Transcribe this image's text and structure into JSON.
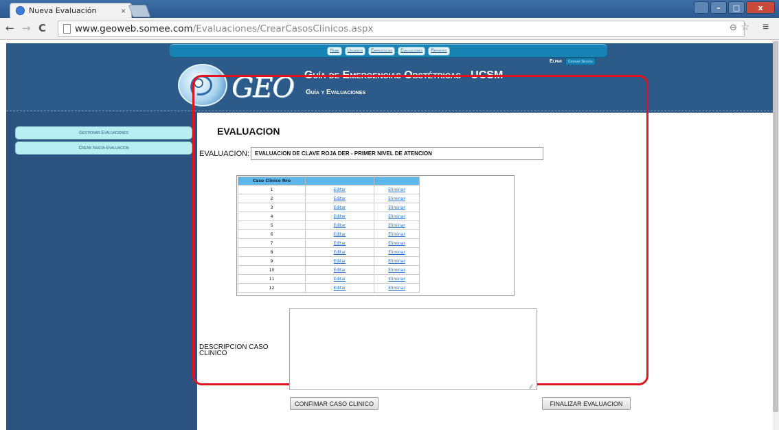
{
  "browser": {
    "tab_title": "Nueva Evaluación",
    "tab_close": "×",
    "url_domain": "www.geoweb.somee.com",
    "url_path": "/Evaluaciones/CrearCasosClinicos.aspx",
    "nav_back": "←",
    "nav_forward": "→",
    "nav_reload": "C",
    "zoom_icon": "🔍",
    "star_icon": "☆",
    "menu_icon": "≡"
  },
  "header": {
    "menu": [
      "Home",
      "Usuarios",
      "Emergencias",
      "Evaluaciones",
      "Reportes"
    ],
    "user_name": "Elper",
    "logout_label": "Cerrar Sesión",
    "logo_text": "GEO",
    "title": "Guía de Emergencias Obstétricas - UCSM",
    "subtitle": "Guía y Evaluaciones"
  },
  "sidebar": {
    "items": [
      "Gestionar Evaluaciones",
      "Crear Nueva Evaluacion"
    ]
  },
  "main": {
    "title": "EVALUACION",
    "eval_label": "EVALUACION:",
    "eval_value": "EVALUACION DE CLAVE ROJA DER - PRIMER NIVEL DE ATENCION",
    "grid": {
      "headers": [
        "Caso Clinico Nro",
        "",
        ""
      ],
      "edit_label": "Editar",
      "delete_label": "Eliminar",
      "rows": [
        "1",
        "2",
        "3",
        "4",
        "5",
        "6",
        "7",
        "8",
        "9",
        "10",
        "11",
        "12"
      ]
    },
    "desc_label": "DESCRIPCION CASO CLINICO",
    "confirm_label": "CONFIMAR CASO CLINICO",
    "finish_label": "FINALIZAR EVALUACION"
  }
}
